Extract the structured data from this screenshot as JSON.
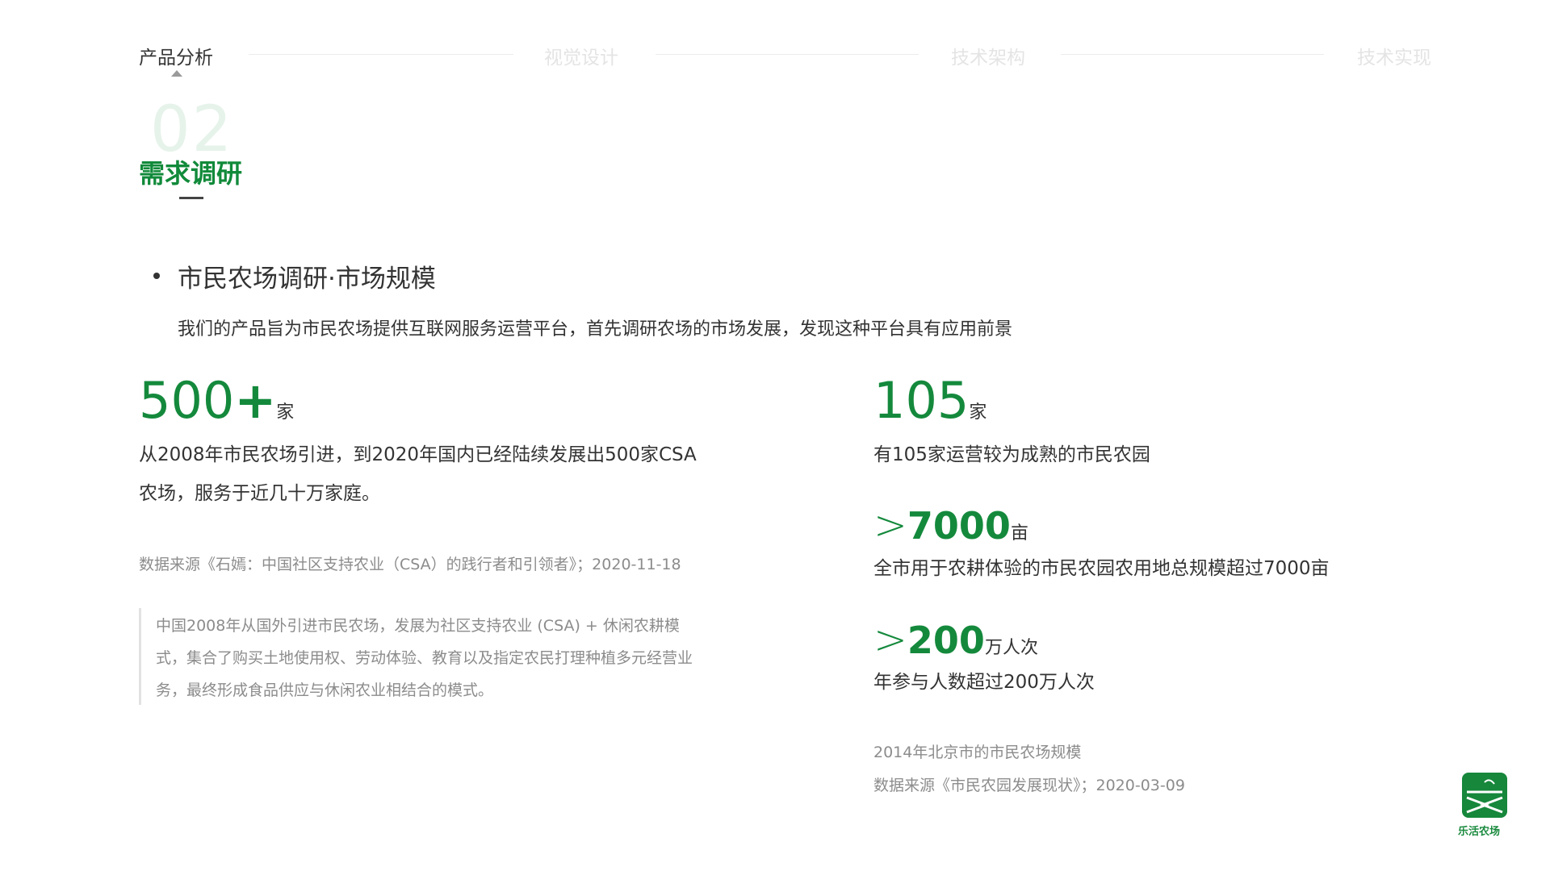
{
  "nav": {
    "items": [
      {
        "label": "产品分析",
        "active": true
      },
      {
        "label": "视觉设计",
        "active": false
      },
      {
        "label": "技术架构",
        "active": false
      },
      {
        "label": "技术实现",
        "active": false
      }
    ]
  },
  "section": {
    "number": "02",
    "title": "需求调研"
  },
  "subheading": "市民农场调研·市场规模",
  "intro": "我们的产品旨为市民农场提供互联网服务运营平台，首先调研农场的市场发展，发现这种平台具有应用前景",
  "left": {
    "stat_number": "500",
    "stat_plus": "+",
    "stat_unit": "家",
    "desc_line1": "从2008年市民农场引进，到2020年国内已经陆续发展出500家CSA",
    "desc_line2": "农场，服务于近几十万家庭。",
    "source": "数据来源《石嫣：中国社区支持农业（CSA）的践行者和引领者》；2020-11-18",
    "quote": "中国2008年从国外引进市民农场，发展为社区支持农业 (CSA) + 休闲农耕模式，集合了购买土地使用权、劳动体验、教育以及指定农民打理种植多元经营业务，最终形成食品供应与休闲农业相结合的模式。"
  },
  "right": {
    "stat1_number": "105",
    "stat1_unit": "家",
    "stat1_desc": "有105家运营较为成熟的市民农园",
    "stat2_prefix": ">",
    "stat2_number": "7000",
    "stat2_unit": "亩",
    "stat2_desc": "全市用于农耕体验的市民农园农用地总规模超过7000亩",
    "stat3_prefix": ">",
    "stat3_number": "200",
    "stat3_unit": "万人次",
    "stat3_desc": "年参与人数超过200万人次",
    "note": "2014年北京市的市民农场规模",
    "source": "数据来源《市民农园发展现状》；2020-03-09"
  },
  "logo": {
    "text": "乐活农场",
    "color": "#16873b"
  },
  "colors": {
    "accent": "#14893c",
    "text": "#333333",
    "muted": "#8c8c8c"
  }
}
